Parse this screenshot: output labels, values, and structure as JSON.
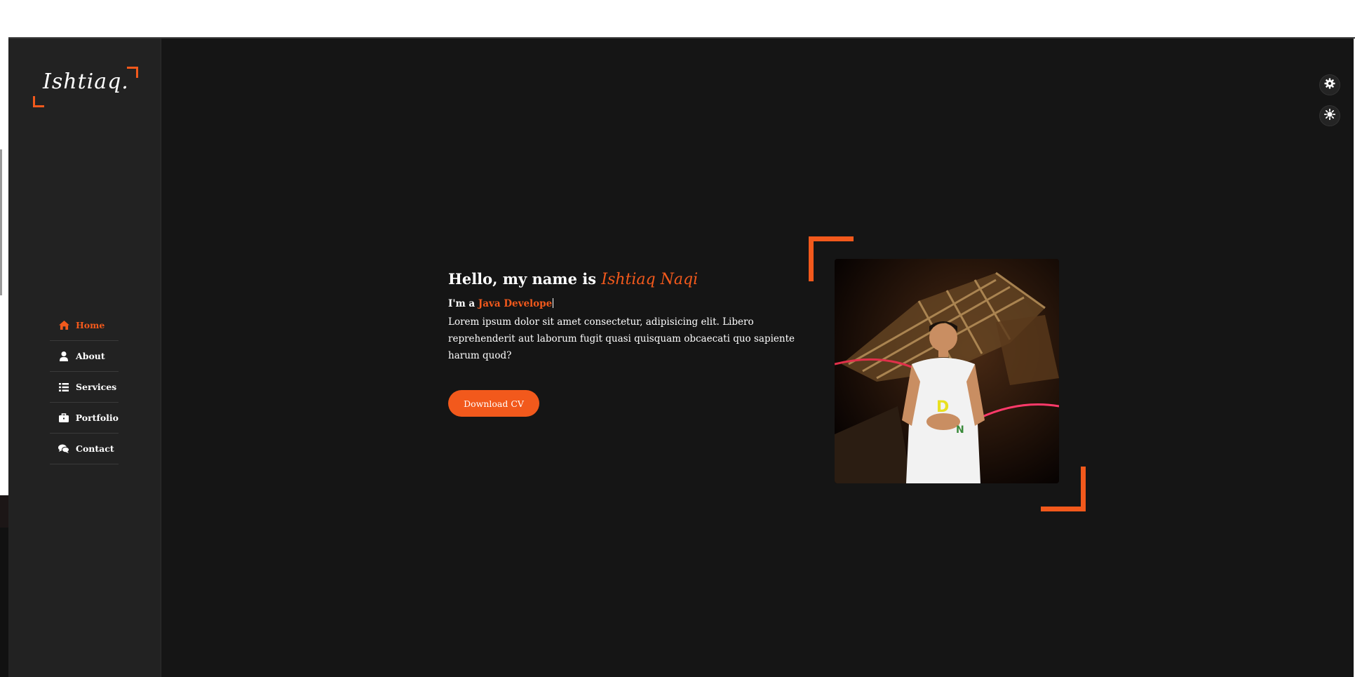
{
  "brand": {
    "logo_text": "Ishtiaq."
  },
  "sidebar": {
    "items": [
      {
        "label": "Home",
        "icon": "home-icon",
        "active": true
      },
      {
        "label": "About",
        "icon": "user-icon",
        "active": false
      },
      {
        "label": "Services",
        "icon": "list-icon",
        "active": false
      },
      {
        "label": "Portfolio",
        "icon": "briefcase-icon",
        "active": false
      },
      {
        "label": "Contact",
        "icon": "chat-icon",
        "active": false
      }
    ]
  },
  "hero": {
    "greeting": "Hello, my name is ",
    "name": "Ishtiaq Naqi",
    "role_prefix": "I'm a ",
    "role": "Java Develope",
    "description": "Lorem ipsum dolor sit amet consectetur, adipisicing elit. Libero reprehenderit aut laborum fugit quasi quisquam obcaecati quo sapiente harum quod?",
    "button_label": "Download CV"
  },
  "toolbar": {
    "icons": [
      "gear-icon",
      "sun-icon"
    ]
  },
  "colors": {
    "accent": "#f2591c",
    "sidebar_bg": "#222222",
    "main_bg": "#151515",
    "text": "#ffffff"
  }
}
